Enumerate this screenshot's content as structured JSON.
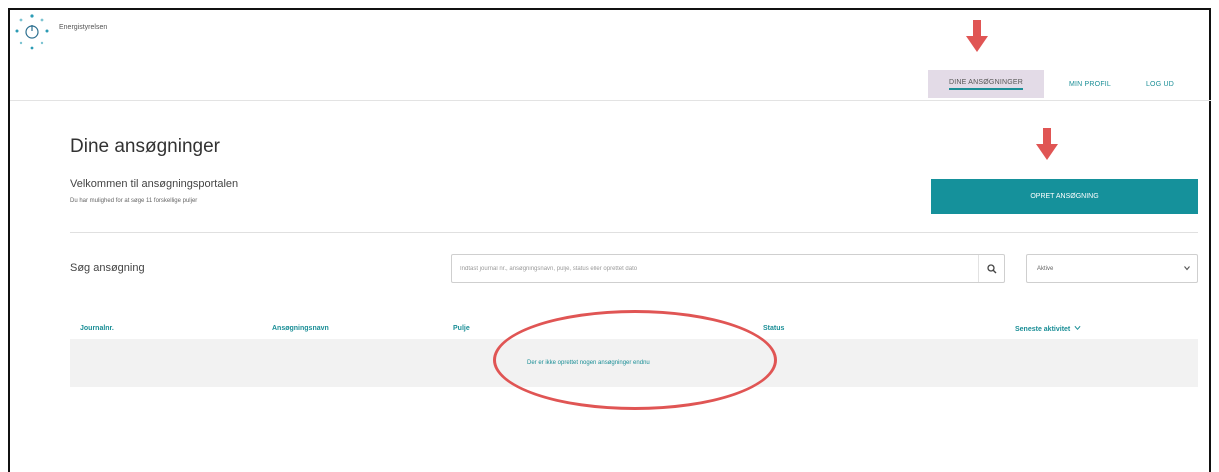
{
  "header": {
    "app_name": "Energistyrelsen",
    "nav": {
      "my_applications": "DINE ANSØGNINGER",
      "my_profile": "MIN PROFIL",
      "logout": "LOG UD"
    }
  },
  "main": {
    "title": "Dine ansøgninger",
    "welcome_title": "Velkommen til ansøgningsportalen",
    "welcome_subtitle": "Du har mulighed for at søge 11 forskellige puljer",
    "create_button": "OPRET ANSØGNING",
    "search": {
      "label": "Søg ansøgning",
      "placeholder": "Indtast journal nr., ansøgningsnavn, pulje, status eller oprettet dato",
      "status_value": "Aktive"
    },
    "table": {
      "columns": [
        "Journalnr.",
        "Ansøgningsnavn",
        "Pulje",
        "Status",
        "Seneste aktivitet"
      ],
      "empty_message": "Der er ikke oprettet nogen ansøgninger endnu"
    }
  },
  "colors": {
    "accent": "#15919b",
    "annotation": "#e05554",
    "nav_highlight": "#e3dbe7"
  },
  "icons": {
    "logo": "power-dots-logo-icon",
    "search": "search-icon",
    "chevron": "chevron-down-icon",
    "sort": "sort-chevron-icon"
  }
}
